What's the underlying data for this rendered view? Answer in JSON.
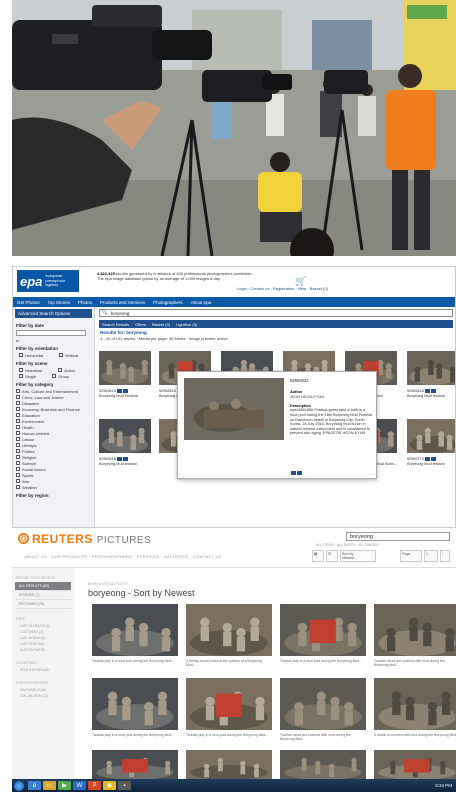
{
  "epa": {
    "logo_big": "epa",
    "logo_small": [
      "european",
      "pressphoto",
      "agency"
    ],
    "tagline_count": "4,822,325",
    "tagline_rest": " photos generated by a network of 400 professional photographers worldwide.",
    "tagline_line2": "The epa image database grows by an average of 1,000 images a day.",
    "links": "Login · Contact us · Registration · Help · Basket (0)",
    "nav": [
      "Get Photos",
      "Top Stories",
      "Photos",
      "Products and Services",
      "Photographers",
      "About epa"
    ],
    "sidebar": {
      "header": "Advanced Search Options",
      "by_date": "Filter by date",
      "date_to": "to",
      "by_orientation": "Filter by orientation",
      "orientation": [
        "Horizontal",
        "Vertical"
      ],
      "by_scene": "Filter by scene",
      "scene": [
        "Headshot",
        "Action",
        "Single",
        "Group"
      ],
      "by_category": "Filter by category",
      "categories": [
        "Arts, Culture and Entertainment",
        "Crime, Law and Justice",
        "Disasters",
        "Economy, Business and Finance",
        "Education",
        "Environment",
        "Health",
        "Human Interest",
        "Labour",
        "Lifestyle",
        "Politics",
        "Religion",
        "Science",
        "Social Issues",
        "Sports",
        "War",
        "Weather"
      ],
      "by_region": "Filter by region"
    },
    "search_value": "boryeong",
    "tabs": [
      "Search Results",
      "Offers",
      "Basket (0)",
      "Lightbox (0)"
    ],
    "results_label": "Results for: boryeong",
    "controls": "1 - 40 of 141 results · Media per page: 40 Media · Image preview: active",
    "captions": [
      {
        "id": "52969416",
        "title": "Boryeong Mud Festival"
      },
      {
        "id": "52968416",
        "title": "Boryeong Mud festival"
      },
      {
        "id": "52968416",
        "title": "Boryeong Mud festival"
      },
      {
        "id": "52969416",
        "title": "Boryeong Mud festival"
      },
      {
        "id": "52969416",
        "title": "Boryeong Mud festival"
      },
      {
        "id": "52969414",
        "title": "Boryeong Mud festival"
      },
      {
        "id": "52969413",
        "title": "Boryeong Mud festival"
      },
      {
        "id": "52968994",
        "title": "Boryeong Mud Festival Kicks..."
      },
      {
        "id": "52969770",
        "title": "Boryeong Mud festival"
      }
    ],
    "popup": {
      "id": "52968022",
      "author_label": "Author",
      "author": "JEON HEON-KYUN",
      "description_label": "Description",
      "description": "epa04861856 Festival-goers take a bath in a mud pool during the 18th Boryeong Mud Festival on Daecheon beach in Boryeong City, South Korea, 18 July 2015. Boryeong mud is rich in natural mineral component and is considered to prevent skin aging. EPA/JEON HEON-KYUN"
    }
  },
  "reuters": {
    "logo": "REUTERS",
    "logo_suffix": "PICTURES",
    "nav": "ABOUT US · OUR PRODUCTS · PHOTOGRAPHERS · SERVICES · GALLERIES · CONTACT US",
    "search_value": "boryeong",
    "filters": "ALL ITEMS · ALL DATES · ALL IMAGES · ...",
    "controls": [
      "Sort by",
      "Newest",
      "Page",
      "1"
    ],
    "sidebar": {
      "title1": "REFINE YOUR SEARCH",
      "items": [
        "ALL RESULTS (82)",
        "STORIES (7)",
        "PICTURES (75)"
      ],
      "title2": "DATE",
      "dates": [
        "LAST 24 HOURS (0)",
        "LAST WEEK (0)",
        "LAST MONTH (0)",
        "LAST YEAR (62)",
        "CUSTOM DATES"
      ],
      "title3": "COUNTRIES",
      "countries": [
        "SOUTH KOREA (82)"
      ],
      "title4": "PHOTOGRAPHERS",
      "photographers": [
        "KIM HONG-JI (40)",
        "LEE JAE-WON (22)"
      ]
    },
    "crumb": "SEARCH RESULTS FOR",
    "heading": "boryeong - Sort by Newest",
    "captions": [
      "Tourists play in a mud pool during the Boryeong Mud...",
      "A foreign tourist looks at the posters of a Boryeong Mud...",
      "Tourists play in a mud pool during the Boryeong Mud...",
      "Tourists' faces are covered with mud during the Boryeong Mud...",
      "Tourists play in a mud pool during the Boryeong Mud...",
      "Tourists play in a mud pool during the Boryeong Mud...",
      "Tourists' faces are covered with mud during the Boryeong Mud...",
      "A tourist is covered with mud during the Boryeong Mud..."
    ]
  },
  "taskbar": {
    "clock": "8:34 PM"
  }
}
